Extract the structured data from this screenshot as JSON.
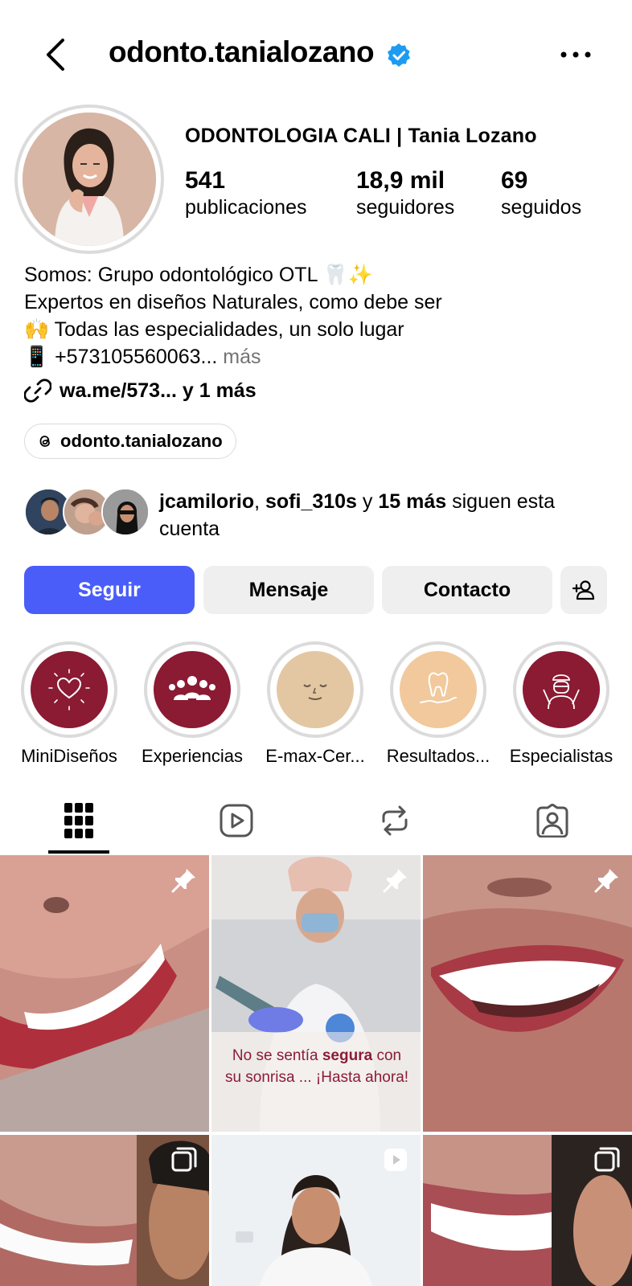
{
  "header": {
    "username": "odonto.tanialozano",
    "back_icon": "chevron-left-icon",
    "verified_icon": "verified-badge-icon",
    "more_icon": "more-horizontal-icon"
  },
  "profile": {
    "display_name": "ODONTOLOGIA CALI | Tania Lozano",
    "stats": [
      {
        "value": "541",
        "label": "publicaciones"
      },
      {
        "value": "18,9 mil",
        "label": "seguidores"
      },
      {
        "value": "69",
        "label": "seguidos"
      }
    ],
    "bio_lines": [
      "Somos: Grupo odontológico OTL 🦷✨",
      "Expertos en diseños Naturales, como debe ser",
      "🙌 Todas las especialidades, un solo lugar",
      "📱 +573105560063..."
    ],
    "bio_more": " más",
    "link_text": "wa.me/573...  y 1 más",
    "threads_handle": "odonto.tanialozano"
  },
  "followed_by": {
    "user1": "jcamilorio",
    "sep1": ", ",
    "user2": "sofi_310s",
    "sep2": " y ",
    "count": "15 más",
    "suffix": " siguen esta cuenta"
  },
  "actions": {
    "follow": "Seguir",
    "message": "Mensaje",
    "contact": "Contacto",
    "suggest_icon": "add-person-icon"
  },
  "highlights": [
    {
      "label": "MiniDiseños",
      "icon": "heart-sparkle-icon",
      "color": "#8b1a33"
    },
    {
      "label": "Experiencias",
      "icon": "group-people-icon",
      "color": "#8b1a33"
    },
    {
      "label": "E-max-Cer...",
      "icon": "face-icon",
      "color": "#e3c7a3"
    },
    {
      "label": "Resultados...",
      "icon": "tooth-hand-icon",
      "color": "#f1c99c"
    },
    {
      "label": "Especialistas",
      "icon": "dentist-icon",
      "color": "#8b1a33"
    }
  ],
  "tabs": [
    {
      "icon": "grid-icon",
      "active": true
    },
    {
      "icon": "reels-icon",
      "active": false
    },
    {
      "icon": "repost-icon",
      "active": false
    },
    {
      "icon": "tagged-icon",
      "active": false
    }
  ],
  "posts": [
    {
      "badge": "pin-icon"
    },
    {
      "badge": "pin-icon",
      "caption_pre": "No se sentía ",
      "caption_bold": "segura",
      "caption_post": " con",
      "caption_line2": "su sonrisa ... ¡Hasta ahora!"
    },
    {
      "badge": "pin-icon"
    },
    {
      "badge": "carousel-icon"
    },
    {
      "badge": "reel-icon"
    },
    {
      "badge": "carousel-icon"
    }
  ],
  "colors": {
    "primary_button": "#4a5df9",
    "verified": "#1d9bf0",
    "brand_maroon": "#8b1a33"
  }
}
